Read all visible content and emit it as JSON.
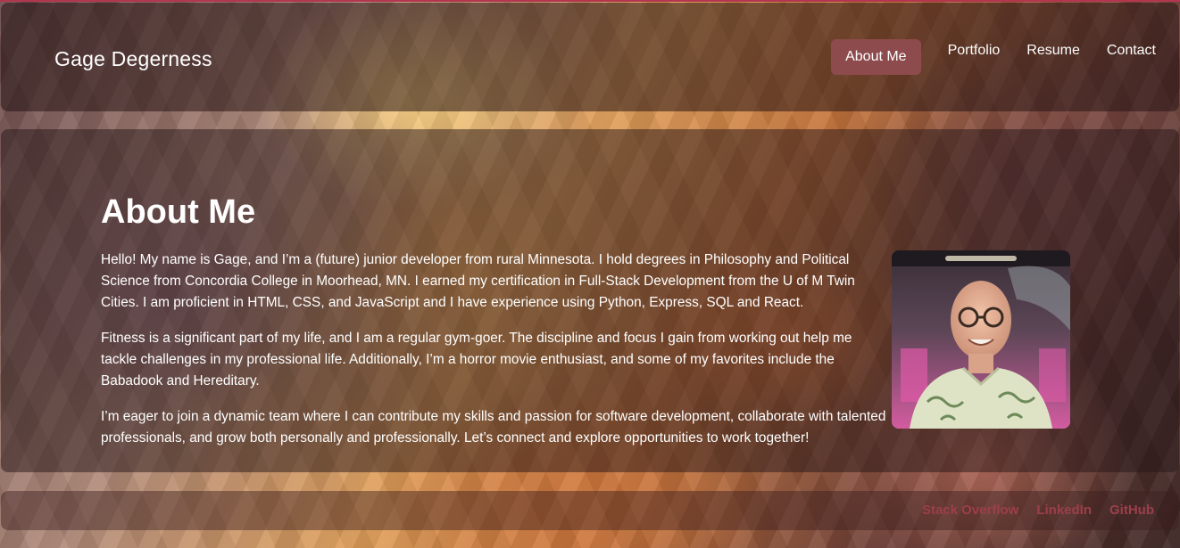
{
  "header": {
    "brand": "Gage Degerness",
    "nav": [
      {
        "label": "About Me",
        "active": true
      },
      {
        "label": "Portfolio",
        "active": false
      },
      {
        "label": "Resume",
        "active": false
      },
      {
        "label": "Contact",
        "active": false
      }
    ]
  },
  "main": {
    "title": "About Me",
    "paragraphs": [
      "Hello! My name is Gage, and I’m a (future) junior developer from rural Minnesota. I hold degrees in Philosophy and Political Science from Concordia College in Moorhead, MN. I earned my certification in Full-Stack Development from the U of M Twin Cities. I am proficient in HTML, CSS, and JavaScript and I have experience using Python, Express, SQL and React.",
      "Fitness is a significant part of my life, and I am a regular gym-goer. The discipline and focus I gain from working out help me tackle challenges in my professional life. Additionally, I’m a horror movie enthusiast, and some of my favorites include the Babadook and Hereditary.",
      "I’m eager to join a dynamic team where I can contribute my skills and passion for software development, collaborate with talented professionals, and grow both personally and professionally. Let’s connect and explore opportunities to work together!"
    ]
  },
  "footer": {
    "links": [
      "Stack Overflow",
      "LinkedIn",
      "GitHub"
    ]
  },
  "colors": {
    "accent": "#8e4b4d",
    "footer_link": "#9c3f4a",
    "top_line": "#b2364f"
  }
}
